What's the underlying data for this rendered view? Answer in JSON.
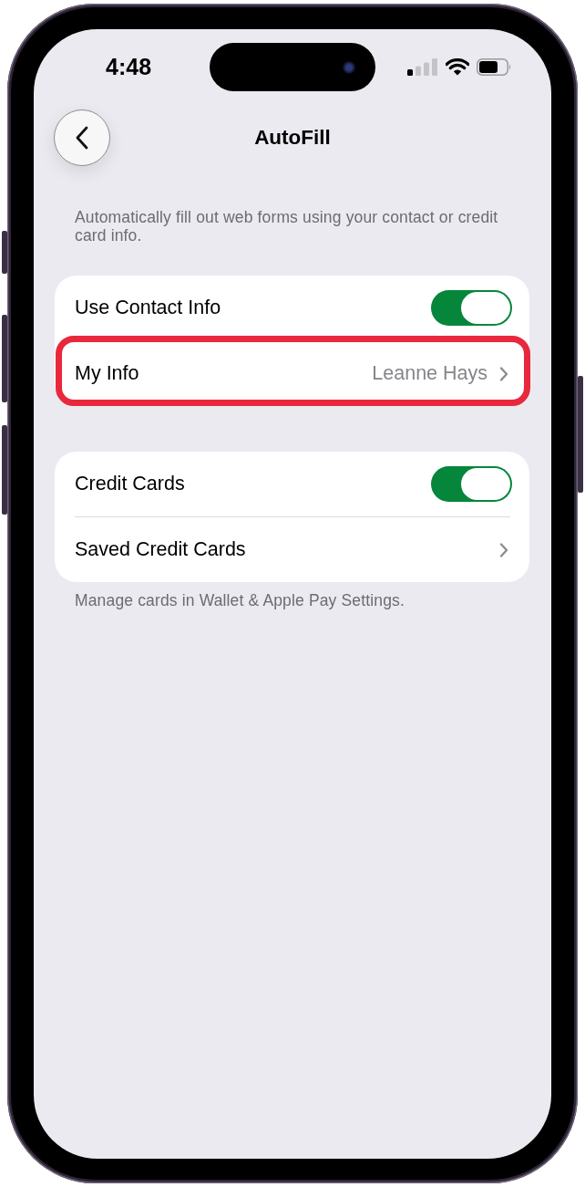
{
  "status_bar": {
    "time": "4:48"
  },
  "nav": {
    "title": "AutoFill"
  },
  "description": "Automatically fill out web forms using your contact or credit card info.",
  "groups": [
    {
      "rows": [
        {
          "kind": "toggle",
          "label": "Use Contact Info",
          "on": true,
          "highlighted": false
        },
        {
          "kind": "link",
          "label": "My Info",
          "value": "Leanne Hays",
          "highlighted": true
        }
      ]
    },
    {
      "rows": [
        {
          "kind": "toggle",
          "label": "Credit Cards",
          "on": true,
          "highlighted": false
        },
        {
          "kind": "link",
          "label": "Saved Credit Cards",
          "highlighted": false
        }
      ],
      "footer": "Manage cards in Wallet & Apple Pay Settings."
    }
  ]
}
